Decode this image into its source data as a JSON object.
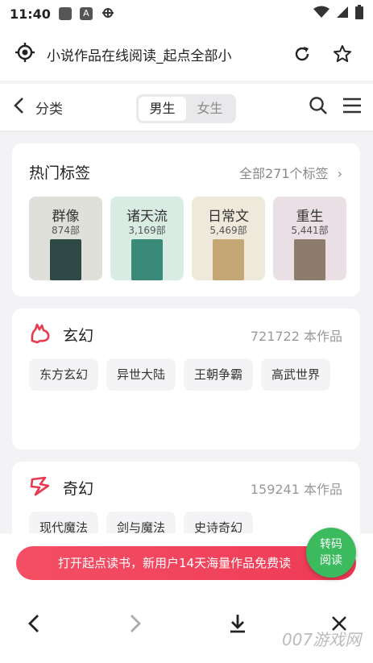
{
  "status": {
    "time": "11:40",
    "a_label": "A"
  },
  "browser": {
    "url_text": "小说作品在线阅读_起点全部小"
  },
  "nav": {
    "back_label": "分类",
    "gender_male": "男生",
    "gender_female": "女生"
  },
  "hot_tags": {
    "title": "热门标签",
    "all_link": "全部271个标签",
    "items": [
      {
        "name": "群像",
        "count": "874部",
        "bg": "#dfe0da",
        "cover": "#2f4a46"
      },
      {
        "name": "诸天流",
        "count": "3,169部",
        "bg": "#d8ece3",
        "cover": "#3a8a7a"
      },
      {
        "name": "日常文",
        "count": "5,469部",
        "bg": "#efe9dc",
        "cover": "#c4a774"
      },
      {
        "name": "重生",
        "count": "5,441部",
        "bg": "#ebdfe6",
        "cover": "#8d7b6b"
      }
    ]
  },
  "categories": [
    {
      "name": "玄幻",
      "count": "721722 本作品",
      "chips": [
        "东方玄幻",
        "异世大陆",
        "王朝争霸",
        "高武世界"
      ]
    },
    {
      "name": "奇幻",
      "count": "159241 本作品",
      "chips": [
        "现代魔法",
        "剑与魔法",
        "史诗奇幻"
      ]
    }
  ],
  "banner": {
    "text": "打开起点读书，新用户14天海量作品免费读"
  },
  "fab": {
    "line1": "转码",
    "line2": "阅读"
  },
  "watermark": "007游戏网",
  "colors": {
    "accent": "#e8394f",
    "fab": "#3cba5e"
  }
}
